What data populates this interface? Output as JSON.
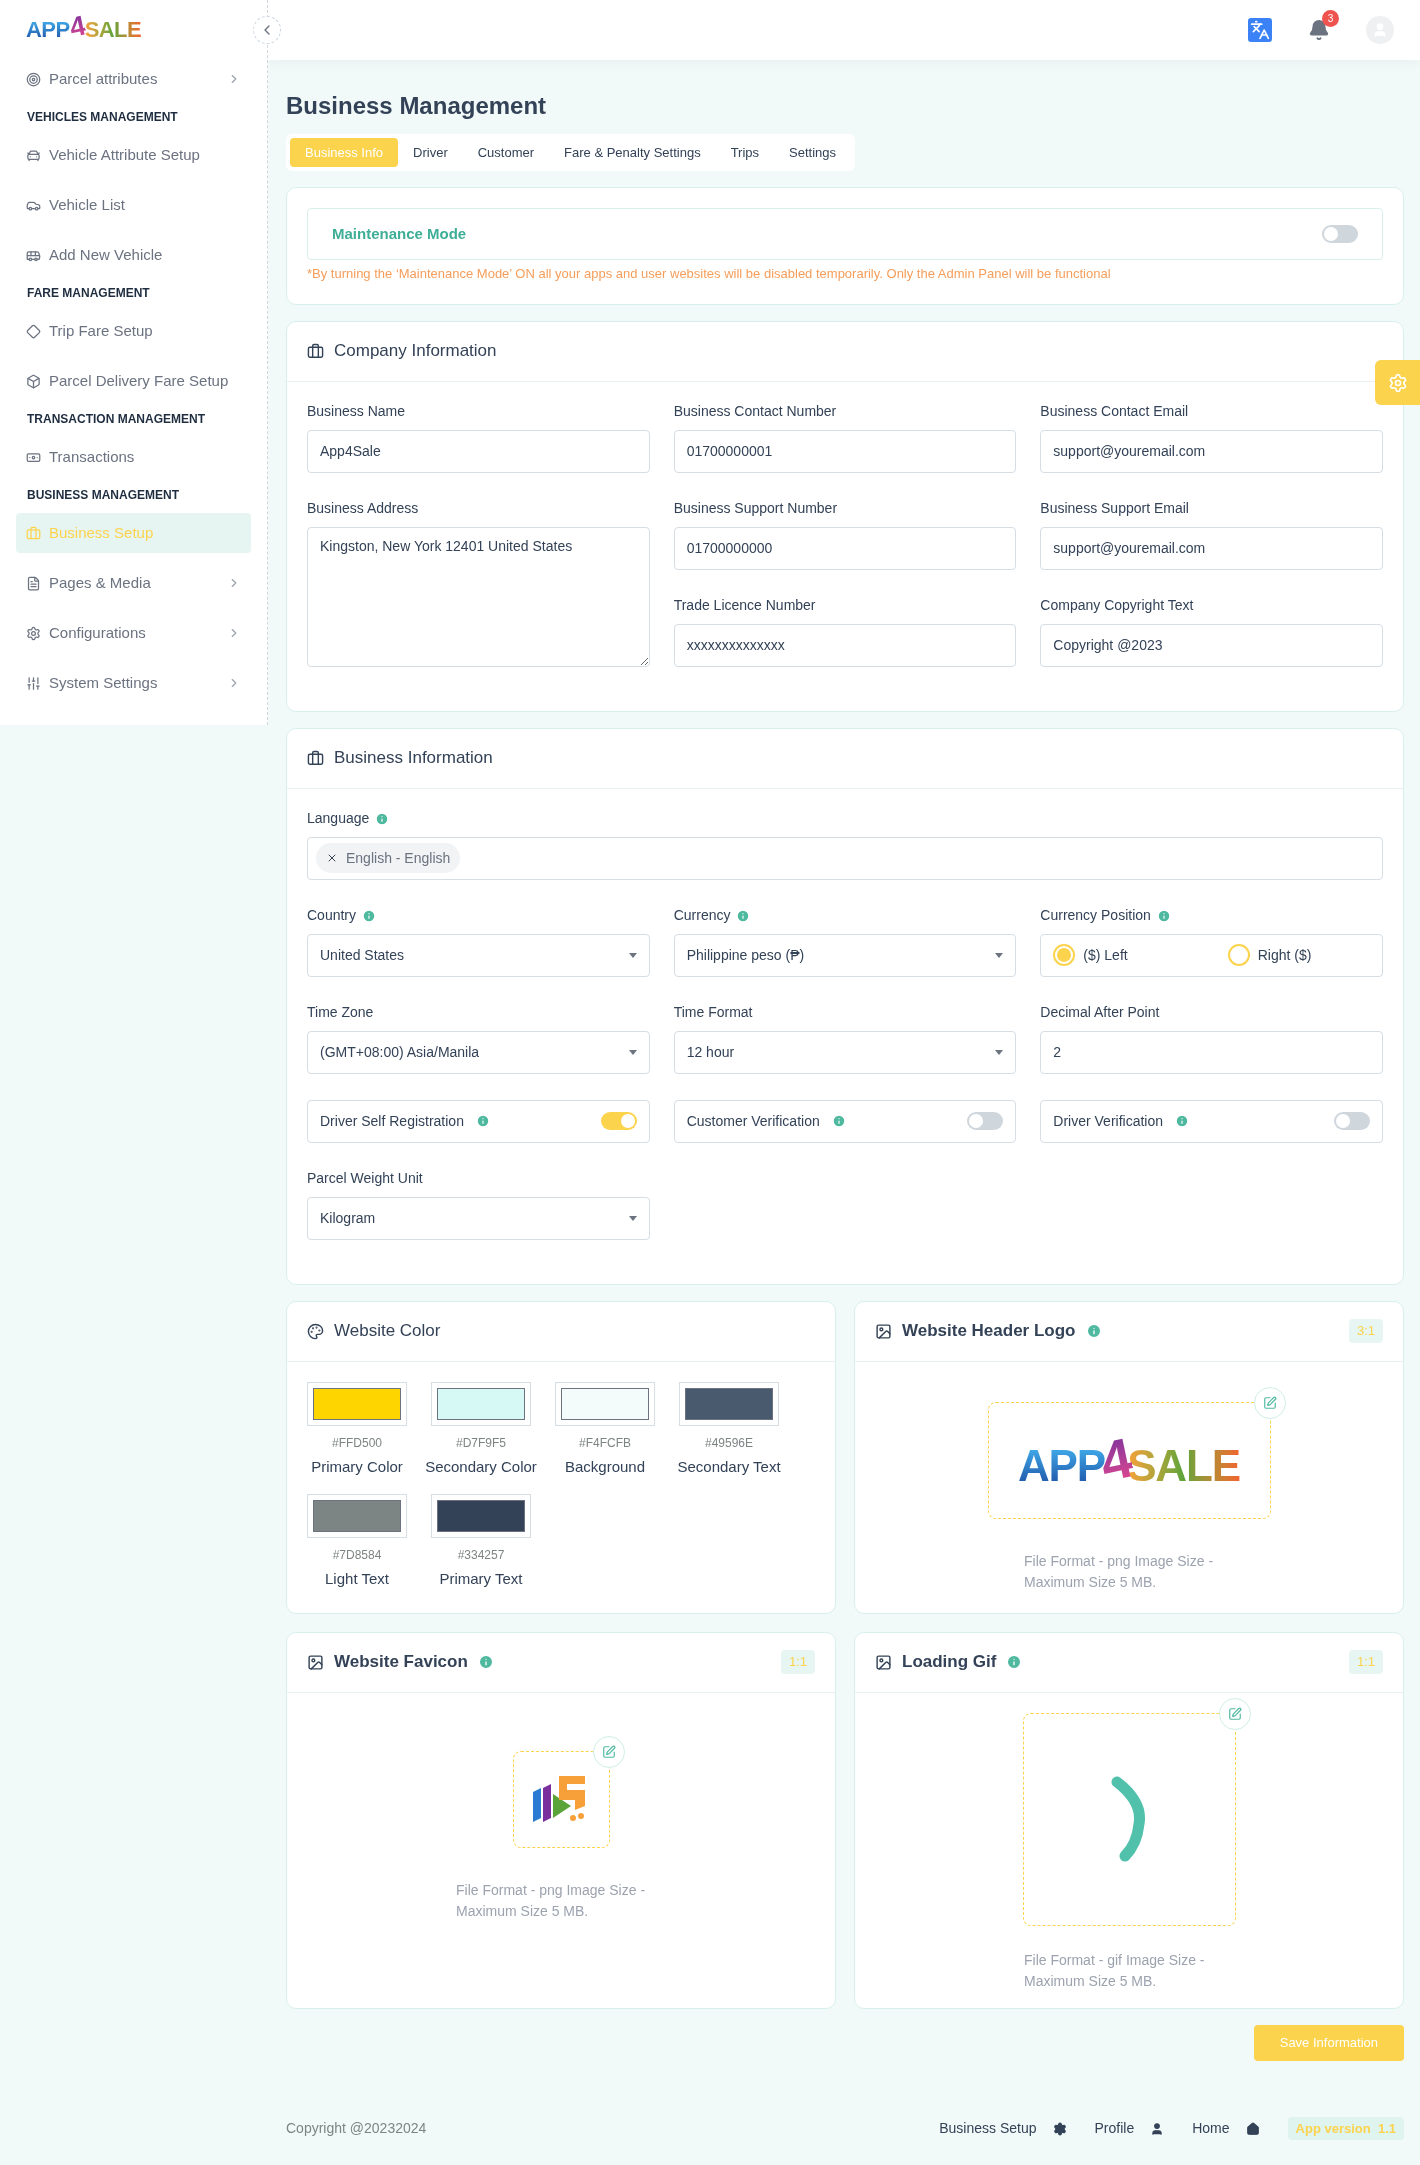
{
  "sidebar": {
    "logo": {
      "left": "APP",
      "middle": "4",
      "right": "SALE"
    },
    "items": [
      {
        "kind": "item",
        "label": "Parcel attributes",
        "expandable": true,
        "selected": false
      },
      {
        "kind": "heading",
        "label": "VEHICLES MANAGEMENT"
      },
      {
        "kind": "item",
        "label": "Vehicle Attribute Setup",
        "expandable": false,
        "selected": false
      },
      {
        "kind": "item",
        "label": "Vehicle List",
        "expandable": false,
        "selected": false
      },
      {
        "kind": "item",
        "label": "Add New Vehicle",
        "expandable": false,
        "selected": false
      },
      {
        "kind": "heading",
        "label": "FARE MANAGEMENT"
      },
      {
        "kind": "item",
        "label": "Trip Fare Setup",
        "expandable": false,
        "selected": false
      },
      {
        "kind": "item",
        "label": "Parcel Delivery Fare Setup",
        "expandable": false,
        "selected": false
      },
      {
        "kind": "heading",
        "label": "TRANSACTION MANAGEMENT"
      },
      {
        "kind": "item",
        "label": "Transactions",
        "expandable": false,
        "selected": false
      },
      {
        "kind": "heading",
        "label": "BUSINESS MANAGEMENT"
      },
      {
        "kind": "item",
        "label": "Business Setup",
        "expandable": false,
        "selected": true
      },
      {
        "kind": "item",
        "label": "Pages & Media",
        "expandable": true,
        "selected": false
      },
      {
        "kind": "item",
        "label": "Configurations",
        "expandable": true,
        "selected": false
      },
      {
        "kind": "item",
        "label": "System Settings",
        "expandable": true,
        "selected": false
      }
    ]
  },
  "topbar": {
    "notification_count": "3"
  },
  "page_title": "Business Management",
  "tabs": [
    {
      "label": "Business Info",
      "selected": true
    },
    {
      "label": "Driver",
      "selected": false
    },
    {
      "label": "Customer",
      "selected": false
    },
    {
      "label": "Fare & Penalty Settings",
      "selected": false
    },
    {
      "label": "Trips",
      "selected": false
    },
    {
      "label": "Settings",
      "selected": false
    }
  ],
  "maintenance": {
    "label": "Maintenance Mode",
    "on": false,
    "note": "*By turning the ‘Maintenance Mode’ ON all your apps and user websites will be disabled temporarily. Only the Admin Panel will be functional"
  },
  "company": {
    "title": "Company Information",
    "columns": [
      [
        {
          "kind": "input",
          "label": "Business Name",
          "value": "App4Sale"
        },
        {
          "kind": "textarea",
          "label": "Business Address",
          "value": "Kingston, New York 12401 United States"
        }
      ],
      [
        {
          "kind": "input",
          "label": "Business Contact Number",
          "value": "01700000001"
        },
        {
          "kind": "input",
          "label": "Business Support Number",
          "value": "01700000000"
        },
        {
          "kind": "input",
          "label": "Trade Licence Number",
          "value": "xxxxxxxxxxxxxx"
        }
      ],
      [
        {
          "kind": "input",
          "label": "Business Contact Email",
          "value": "support@youremail.com"
        },
        {
          "kind": "input",
          "label": "Business Support Email",
          "value": "support@youremail.com"
        },
        {
          "kind": "input",
          "label": "Company Copyright Text",
          "value": "Copyright @2023"
        }
      ]
    ]
  },
  "business": {
    "title": "Business Information",
    "language": {
      "label": "Language",
      "info": true,
      "tags": [
        "English - English"
      ]
    },
    "rows": [
      [
        {
          "kind": "select",
          "label": "Country",
          "info": true,
          "value": "United States"
        },
        {
          "kind": "select",
          "label": "Currency",
          "info": true,
          "value": "Philippine peso (₱)"
        },
        {
          "kind": "radio",
          "label": "Currency Position",
          "info": true,
          "options": [
            {
              "label": "($) Left",
              "selected": true
            },
            {
              "label": "Right ($)",
              "selected": false
            }
          ]
        }
      ],
      [
        {
          "kind": "select",
          "label": "Time Zone",
          "info": false,
          "value": "(GMT+08:00) Asia/Manila"
        },
        {
          "kind": "select",
          "label": "Time Format",
          "info": false,
          "value": "12 hour"
        },
        {
          "kind": "input",
          "label": "Decimal After Point",
          "info": false,
          "value": "2"
        }
      ],
      [
        {
          "kind": "toggle",
          "label": "Driver Self Registration",
          "info": true,
          "on": true
        },
        {
          "kind": "toggle",
          "label": "Customer Verification",
          "info": true,
          "on": false
        },
        {
          "kind": "toggle",
          "label": "Driver Verification",
          "info": true,
          "on": false
        }
      ],
      [
        {
          "kind": "select",
          "label": "Parcel Weight Unit",
          "info": false,
          "value": "Kilogram"
        }
      ]
    ]
  },
  "website_color": {
    "title": "Website Color",
    "swatches": [
      {
        "code": "#FFD500",
        "label": "Primary Color",
        "color": "#ffd500"
      },
      {
        "code": "#D7F9F5",
        "label": "Secondary Color",
        "color": "#d7f9f5"
      },
      {
        "code": "#F4FCFB",
        "label": "Background",
        "color": "#f4fcfb"
      },
      {
        "code": "#49596E",
        "label": "Secondary Text",
        "color": "#49596e"
      },
      {
        "code": "#7D8584",
        "label": "Light Text",
        "color": "#7d8584"
      },
      {
        "code": "#334257",
        "label": "Primary Text",
        "color": "#334257"
      }
    ]
  },
  "uploads": [
    {
      "kind": "logo",
      "title": "Website Header Logo",
      "info": true,
      "ratio": "3:1",
      "logo": {
        "left": "APP",
        "middle": "4",
        "right": "SALE"
      },
      "note": "File Format - png Image Size - Maximum Size 5 MB."
    },
    {
      "kind": "favicon",
      "title": "Website Favicon",
      "info": true,
      "ratio": "1:1",
      "note": "File Format - png Image Size - Maximum Size 5 MB."
    },
    {
      "kind": "spinner",
      "title": "Loading Gif",
      "info": true,
      "ratio": "1:1",
      "note": "File Format - gif Image Size - Maximum Size 5 MB."
    }
  ],
  "save_button": "Save Information",
  "footer": {
    "copyright": "Copyright @20232024",
    "links": [
      {
        "label": "Business Setup"
      },
      {
        "label": "Profile"
      },
      {
        "label": "Home"
      }
    ],
    "version": "App version  1.1"
  }
}
